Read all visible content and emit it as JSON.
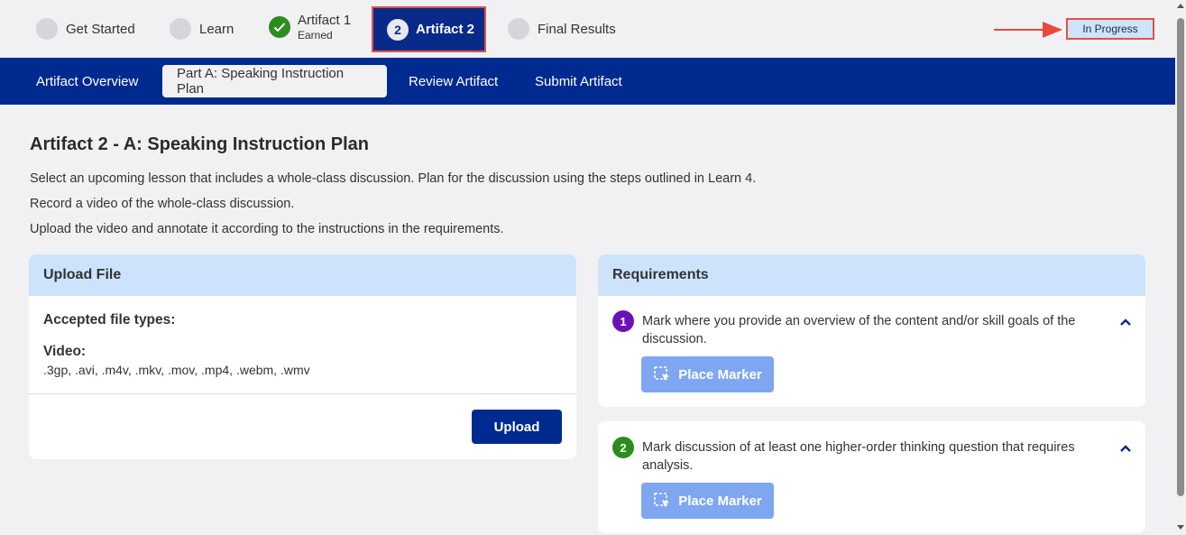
{
  "stepper": {
    "steps": [
      {
        "label": "Get Started"
      },
      {
        "label": "Learn"
      },
      {
        "label": "Artifact 1",
        "sub": "Earned"
      },
      {
        "label": "Artifact 2",
        "number": "2"
      },
      {
        "label": "Final Results"
      }
    ],
    "status": "In Progress"
  },
  "nav": {
    "tabs": [
      {
        "label": "Artifact Overview"
      },
      {
        "label": "Part A: Speaking Instruction Plan"
      },
      {
        "label": "Review Artifact"
      },
      {
        "label": "Submit Artifact"
      }
    ]
  },
  "page": {
    "title": "Artifact 2 - A: Speaking Instruction Plan",
    "instructions": [
      "Select an upcoming lesson that includes a whole-class discussion. Plan for the discussion using the steps outlined in Learn 4.",
      "Record a video of the whole-class discussion.",
      "Upload the video and annotate it according to the instructions in the requirements."
    ]
  },
  "upload": {
    "header": "Upload File",
    "accepted_title": "Accepted file types:",
    "video_title": "Video:",
    "video_types": ".3gp, .avi, .m4v, .mkv, .mov, .mp4, .webm, .wmv",
    "button": "Upload"
  },
  "requirements": {
    "header": "Requirements",
    "items": [
      {
        "number": "1",
        "text": "Mark where you provide an overview of the content and/or skill goals of the discussion.",
        "button": "Place Marker",
        "color": "#6a12b8"
      },
      {
        "number": "2",
        "text": "Mark discussion of at least one higher-order thinking question that requires analysis.",
        "button": "Place Marker",
        "color": "#2e8b1f"
      }
    ]
  },
  "colors": {
    "primary": "#002a8f",
    "accent_header": "#cde3fc",
    "highlight": "#e05243",
    "marker_button": "#7ea6f1"
  }
}
